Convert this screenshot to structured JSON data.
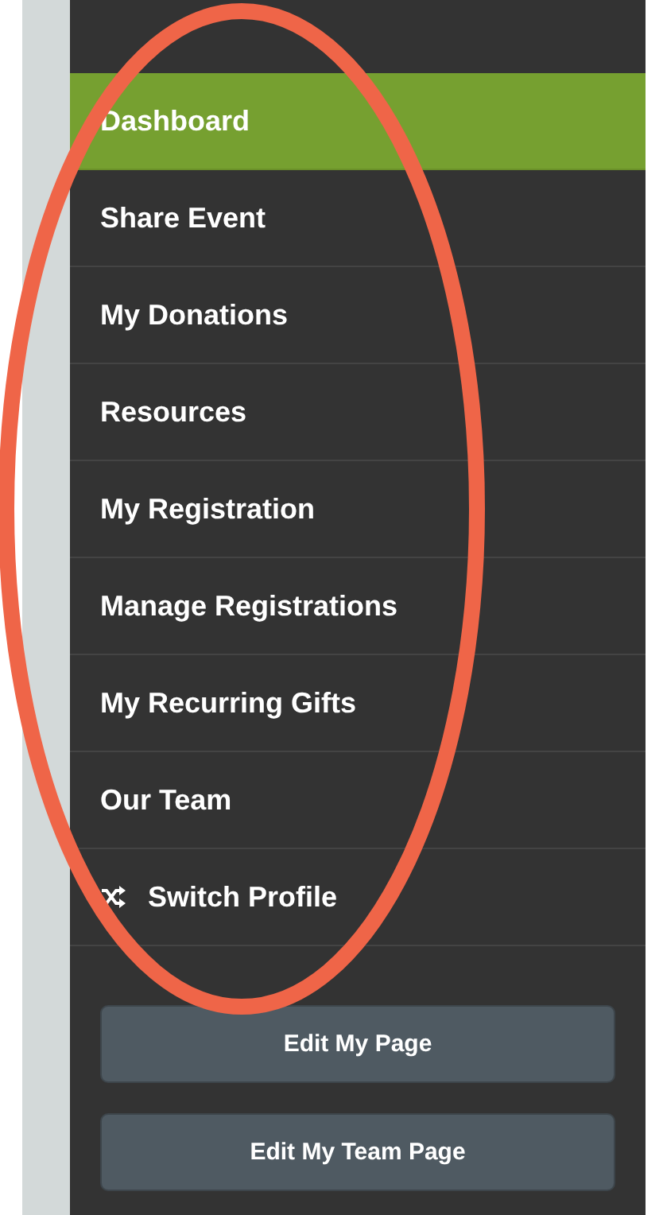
{
  "menu": [
    {
      "label": "Dashboard",
      "kind": "link",
      "selected": true
    },
    {
      "label": "Share Event",
      "kind": "link",
      "selected": false
    },
    {
      "label": "My Donations",
      "kind": "link",
      "selected": false
    },
    {
      "label": "Resources",
      "kind": "link",
      "selected": false
    },
    {
      "label": "My Registration",
      "kind": "link",
      "selected": false
    },
    {
      "label": "Manage Registrations",
      "kind": "link",
      "selected": false
    },
    {
      "label": "My Recurring Gifts",
      "kind": "link",
      "selected": false
    },
    {
      "label": "Our Team",
      "kind": "link",
      "selected": false
    },
    {
      "label": "Switch Profile",
      "kind": "switch",
      "selected": false
    }
  ],
  "buttons": [
    "Edit My Page",
    "Edit My Team Page"
  ]
}
